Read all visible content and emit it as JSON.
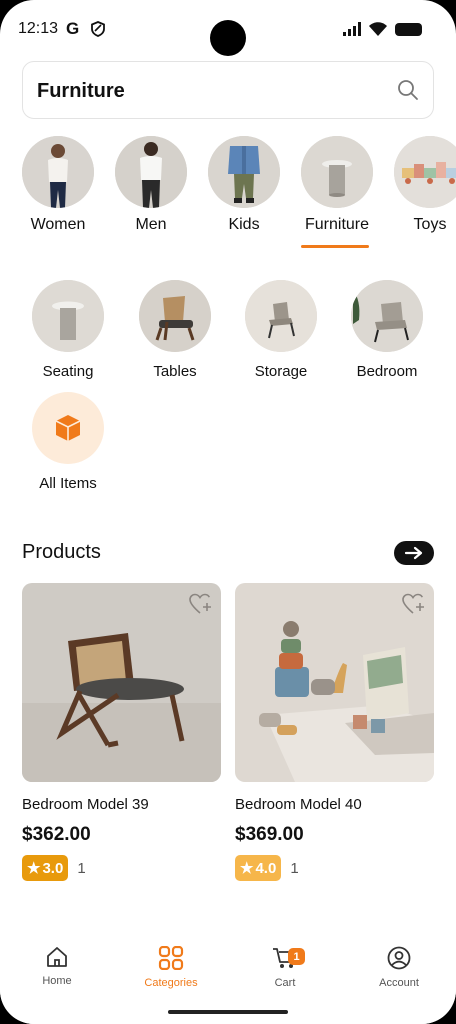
{
  "status_bar": {
    "time": "12:13",
    "g_letter": "G"
  },
  "search": {
    "query": "Furniture"
  },
  "categories": [
    {
      "label": "Women",
      "active": false
    },
    {
      "label": "Men",
      "active": false
    },
    {
      "label": "Kids",
      "active": false
    },
    {
      "label": "Furniture",
      "active": true
    },
    {
      "label": "Toys",
      "active": false
    }
  ],
  "subcategories": [
    {
      "label": "Seating"
    },
    {
      "label": "Tables"
    },
    {
      "label": "Storage"
    },
    {
      "label": "Bedroom"
    },
    {
      "label": "All Items"
    }
  ],
  "products_section": {
    "title": "Products"
  },
  "products": [
    {
      "name": "Bedroom Model 39",
      "price": "$362.00",
      "rating": "3.0",
      "reviews": "1",
      "rating_color": "#e89a0c"
    },
    {
      "name": "Bedroom Model 40",
      "price": "$369.00",
      "rating": "4.0",
      "reviews": "1",
      "rating_color": "#f6b64a"
    }
  ],
  "bottom_nav": {
    "items": [
      {
        "label": "Home",
        "icon": "home-icon",
        "active": false
      },
      {
        "label": "Categories",
        "icon": "categories-icon",
        "active": true
      },
      {
        "label": "Cart",
        "icon": "cart-icon",
        "active": false,
        "badge": "1"
      },
      {
        "label": "Account",
        "icon": "account-icon",
        "active": false
      }
    ]
  },
  "colors": {
    "accent": "#f07a1a"
  }
}
